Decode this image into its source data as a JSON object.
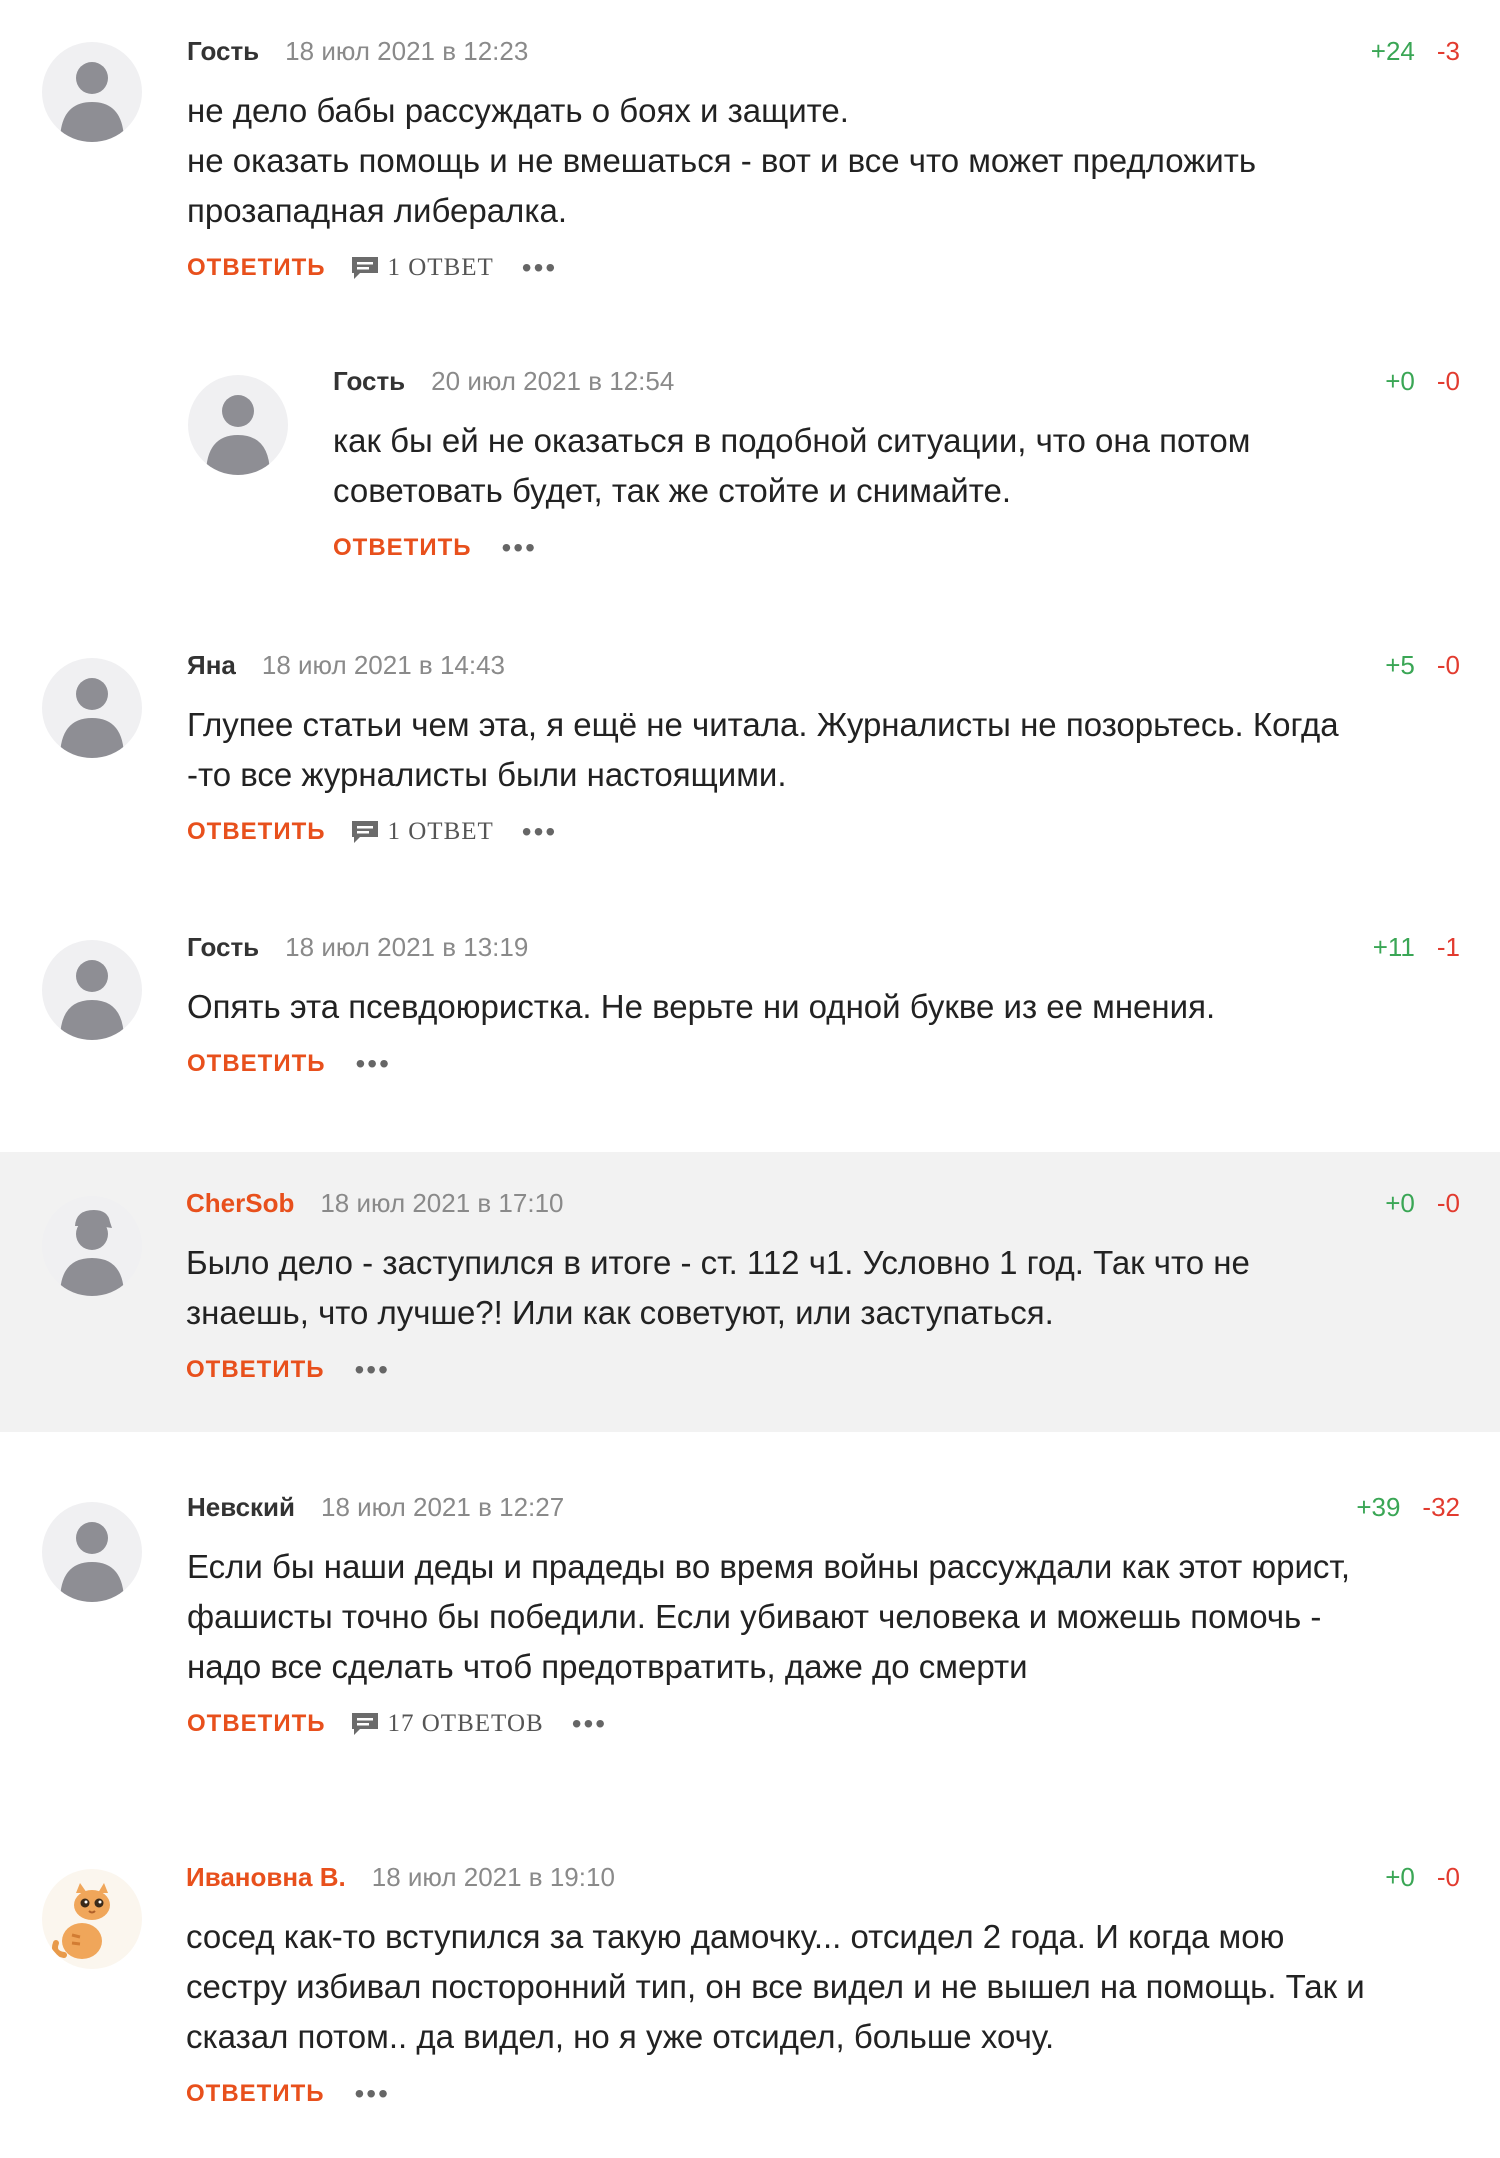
{
  "comments": [
    {
      "author": "Гость",
      "date": "18 июл 2021 в 12:23",
      "up": "+24",
      "down": "-3",
      "lines": [
        "не дело бабы рассуждать о боях и защите.",
        "не оказать помощь и не вмешаться - вот и все что может предложить",
        "прозападная либералка."
      ],
      "reply": "ОТВЕТИТЬ",
      "answers": "1 ОТВЕТ",
      "more": "•••"
    },
    {
      "author": "Гость",
      "date": "20 июл 2021 в 12:54",
      "up": "+0",
      "down": "-0",
      "lines": [
        "как бы ей не оказаться в подобной ситуации, что она потом",
        "советовать будет, так же стойте и снимайте."
      ],
      "reply": "ОТВЕТИТЬ",
      "more": "•••"
    },
    {
      "author": "Яна",
      "date": "18 июл 2021 в 14:43",
      "up": "+5",
      "down": "-0",
      "lines": [
        "Глупее статьи чем эта, я ещё не читала. Журналисты не позорьтесь. Когда",
        "-то все журналисты были настоящими."
      ],
      "reply": "ОТВЕТИТЬ",
      "answers": "1 ОТВЕТ",
      "more": "•••"
    },
    {
      "author": "Гость",
      "date": "18 июл 2021 в 13:19",
      "up": "+11",
      "down": "-1",
      "lines": [
        "Опять эта псевдоюристка. Не верьте ни одной букве из ее мнения."
      ],
      "reply": "ОТВЕТИТЬ",
      "more": "•••"
    },
    {
      "author": "CherSob",
      "date": "18 июл 2021 в 17:10",
      "up": "+0",
      "down": "-0",
      "lines": [
        "Было дело - заступился в итоге - ст. 112 ч1. Условно 1 год. Так что не",
        "знаешь, что лучше?! Или как советуют, или заступаться."
      ],
      "reply": "ОТВЕТИТЬ",
      "more": "•••"
    },
    {
      "author": "Невский",
      "date": "18 июл 2021 в 12:27",
      "up": "+39",
      "down": "-32",
      "lines": [
        "Если бы наши деды и прадеды во время войны рассуждали как этот юрист,",
        "фашисты точно бы победили. Если убивают человека и можешь помочь -",
        "надо все сделать чтоб предотвратить, даже до смерти"
      ],
      "reply": "ОТВЕТИТЬ",
      "answers": "17 ОТВЕТОВ",
      "more": "•••"
    },
    {
      "author": "Ивановна В.",
      "date": "18 июл 2021 в 19:10",
      "up": "+0",
      "down": "-0",
      "lines": [
        "сосед как-то вступился за такую дамочку... отсидел 2 года. И когда мою",
        "сестру избивал посторонний тип, он все видел и не вышел на помощь. Так и",
        "сказал потом.. да видел, но я уже отсидел, больше хочу."
      ],
      "reply": "ОТВЕТИТЬ",
      "more": "•••"
    }
  ]
}
